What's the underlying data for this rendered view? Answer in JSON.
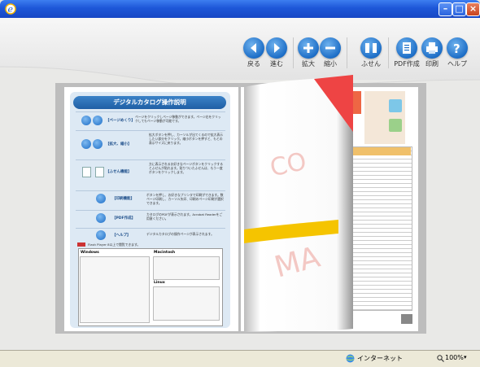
{
  "toolbar": {
    "back_label": "戻る",
    "forward_label": "進む",
    "zoom_in_label": "拡大",
    "zoom_out_label": "縮小",
    "sticky_label": "ふせん",
    "pdf_label": "PDF作成",
    "print_label": "印刷",
    "help_label": "ヘルプ"
  },
  "left_page": {
    "title": "デジタルカタログ操作説明",
    "rows": [
      {
        "label": "【ページめくり】",
        "text": "ページをクリックしページ移動ができます。ページ右をクリックしてもページ移動が可能です。"
      },
      {
        "label": "【拡大、縮小】",
        "text": "拡大ボタンを押し、カーソルが出てくるので拡大表示したい部分をクリック。縮小ボタンを押すと、もとの表示サイズに戻ります。"
      },
      {
        "label": "【ふせん機能】",
        "text": "方に表示されるお好きなページボタンをクリックするとふせんが貼れます。貼りついたふせんは、もう一度ボタンをクリックします。"
      },
      {
        "label": "【印刷機能】",
        "text": "ボタンを押し、お好きなプリンタで印刷ができます。数ページ印刷し、カーソル矢印、印刷のページ印刷が選択できます。"
      },
      {
        "label": "【PDF作成】",
        "text": "カタログのPDFが表示されます。Acrobat Readerをご用意ください。"
      },
      {
        "label": "【ヘルプ】",
        "text": "デジタルカタログの操作ページが表示されます。"
      }
    ],
    "flash_note": "Flash Player 8以上で閲覧できます。",
    "table_headers": {
      "windows": "Windows",
      "macintosh": "Macintosh",
      "linux": "Linux"
    }
  },
  "status": {
    "zone": "インターネット",
    "zoom": "100%"
  }
}
